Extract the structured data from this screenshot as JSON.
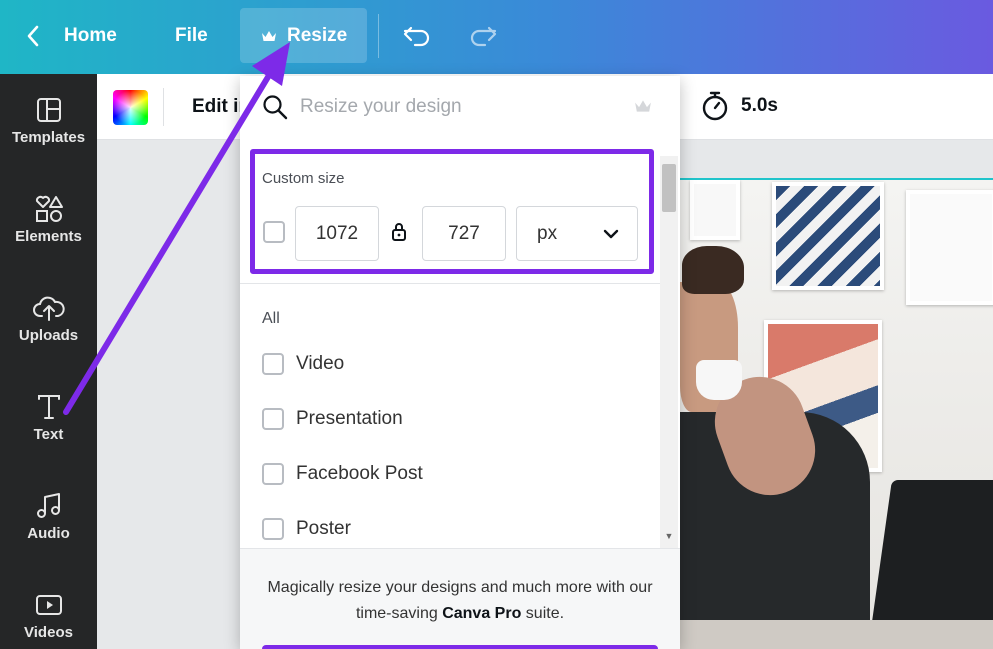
{
  "topbar": {
    "home_label": "Home",
    "file_label": "File",
    "resize_label": "Resize"
  },
  "sidebar": {
    "items": [
      {
        "label": "Templates",
        "icon": "templates-icon"
      },
      {
        "label": "Elements",
        "icon": "elements-icon"
      },
      {
        "label": "Uploads",
        "icon": "uploads-icon"
      },
      {
        "label": "Text",
        "icon": "text-icon"
      },
      {
        "label": "Audio",
        "icon": "audio-icon"
      },
      {
        "label": "Videos",
        "icon": "videos-icon"
      }
    ]
  },
  "toolbar": {
    "edit_label": "Edit image",
    "duration": "5.0s"
  },
  "resize_panel": {
    "search_placeholder": "Resize your design",
    "custom_size_label": "Custom size",
    "width_value": "1072",
    "height_value": "727",
    "unit": "px",
    "all_label": "All",
    "options": [
      "Video",
      "Presentation",
      "Facebook Post",
      "Poster"
    ],
    "promo_text_before": "Magically resize your designs and much more with our time-saving ",
    "promo_brand": "Canva Pro",
    "promo_text_after": " suite."
  },
  "colors": {
    "accent_purple": "#7d2ae8",
    "sidebar_bg": "#252627",
    "topbar_gradient_start": "#1fb6c6",
    "topbar_gradient_end": "#6a5ae0"
  }
}
